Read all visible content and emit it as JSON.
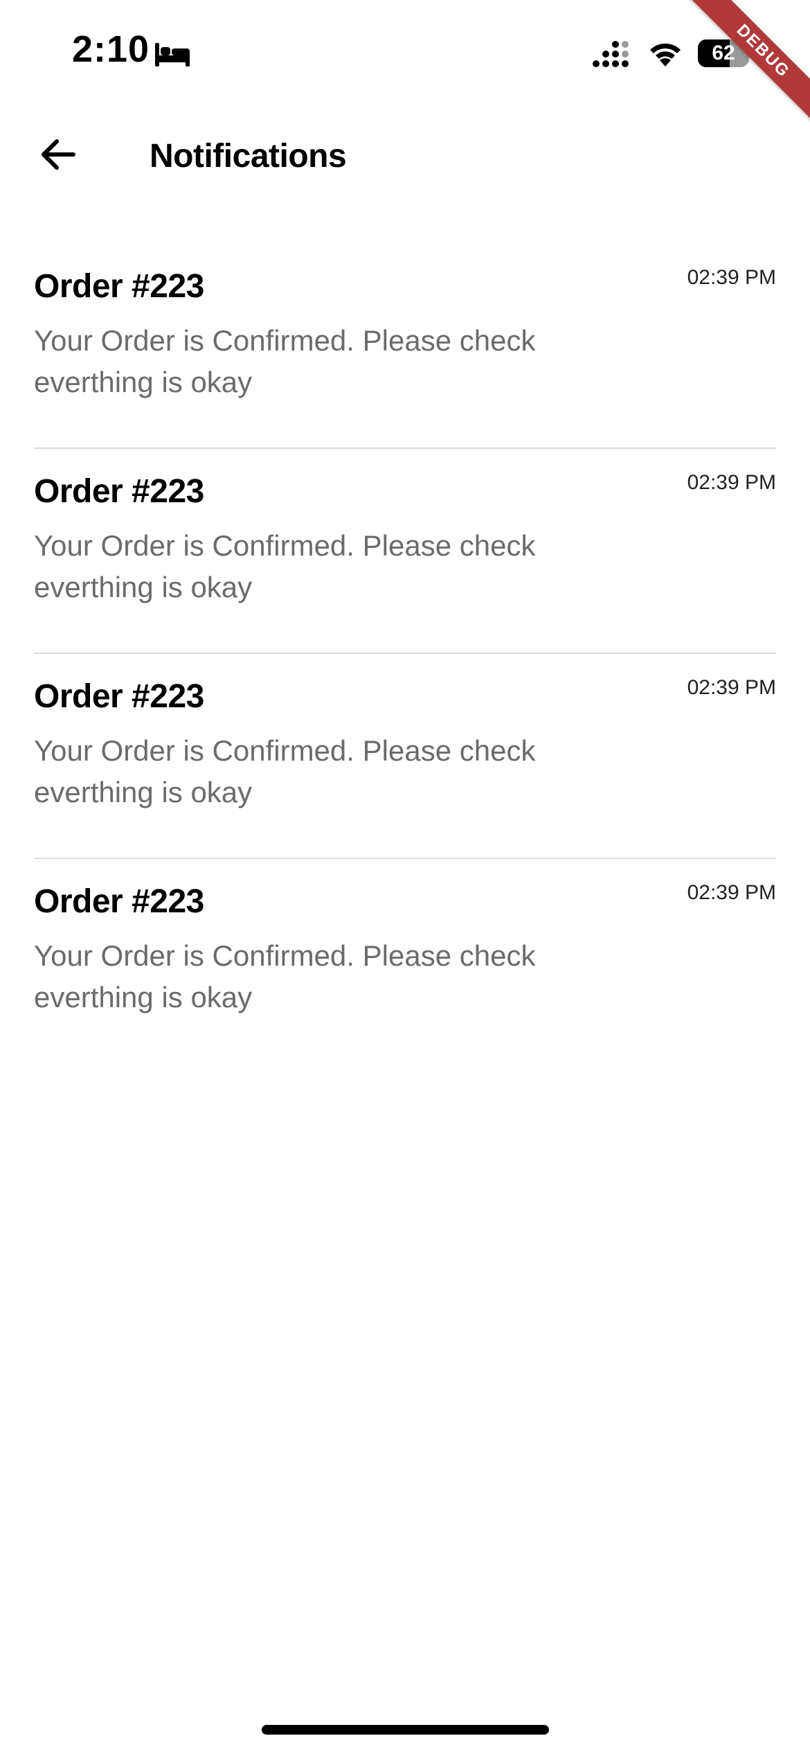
{
  "status_bar": {
    "time": "2:10",
    "battery_level": "62",
    "battery_fraction": 0.62
  },
  "debug_banner": "DEBUG",
  "app_bar": {
    "title": "Notifications",
    "back_icon": "arrow-back-icon"
  },
  "notifications": [
    {
      "title": "Order #223",
      "message": "Your Order is Confirmed. Please check everthing is okay",
      "time": "02:39 PM"
    },
    {
      "title": "Order #223",
      "message": "Your Order is Confirmed. Please check everthing is okay",
      "time": "02:39 PM"
    },
    {
      "title": "Order #223",
      "message": "Your Order is Confirmed. Please check everthing is okay",
      "time": "02:39 PM"
    },
    {
      "title": "Order #223",
      "message": "Your Order is Confirmed. Please check everthing is okay",
      "time": "02:39 PM"
    }
  ],
  "colors": {
    "background": "#ffffff",
    "divider": "#d9d9d9",
    "message_text": "#6b6b6b",
    "debug_banner": "#b03a3a"
  }
}
